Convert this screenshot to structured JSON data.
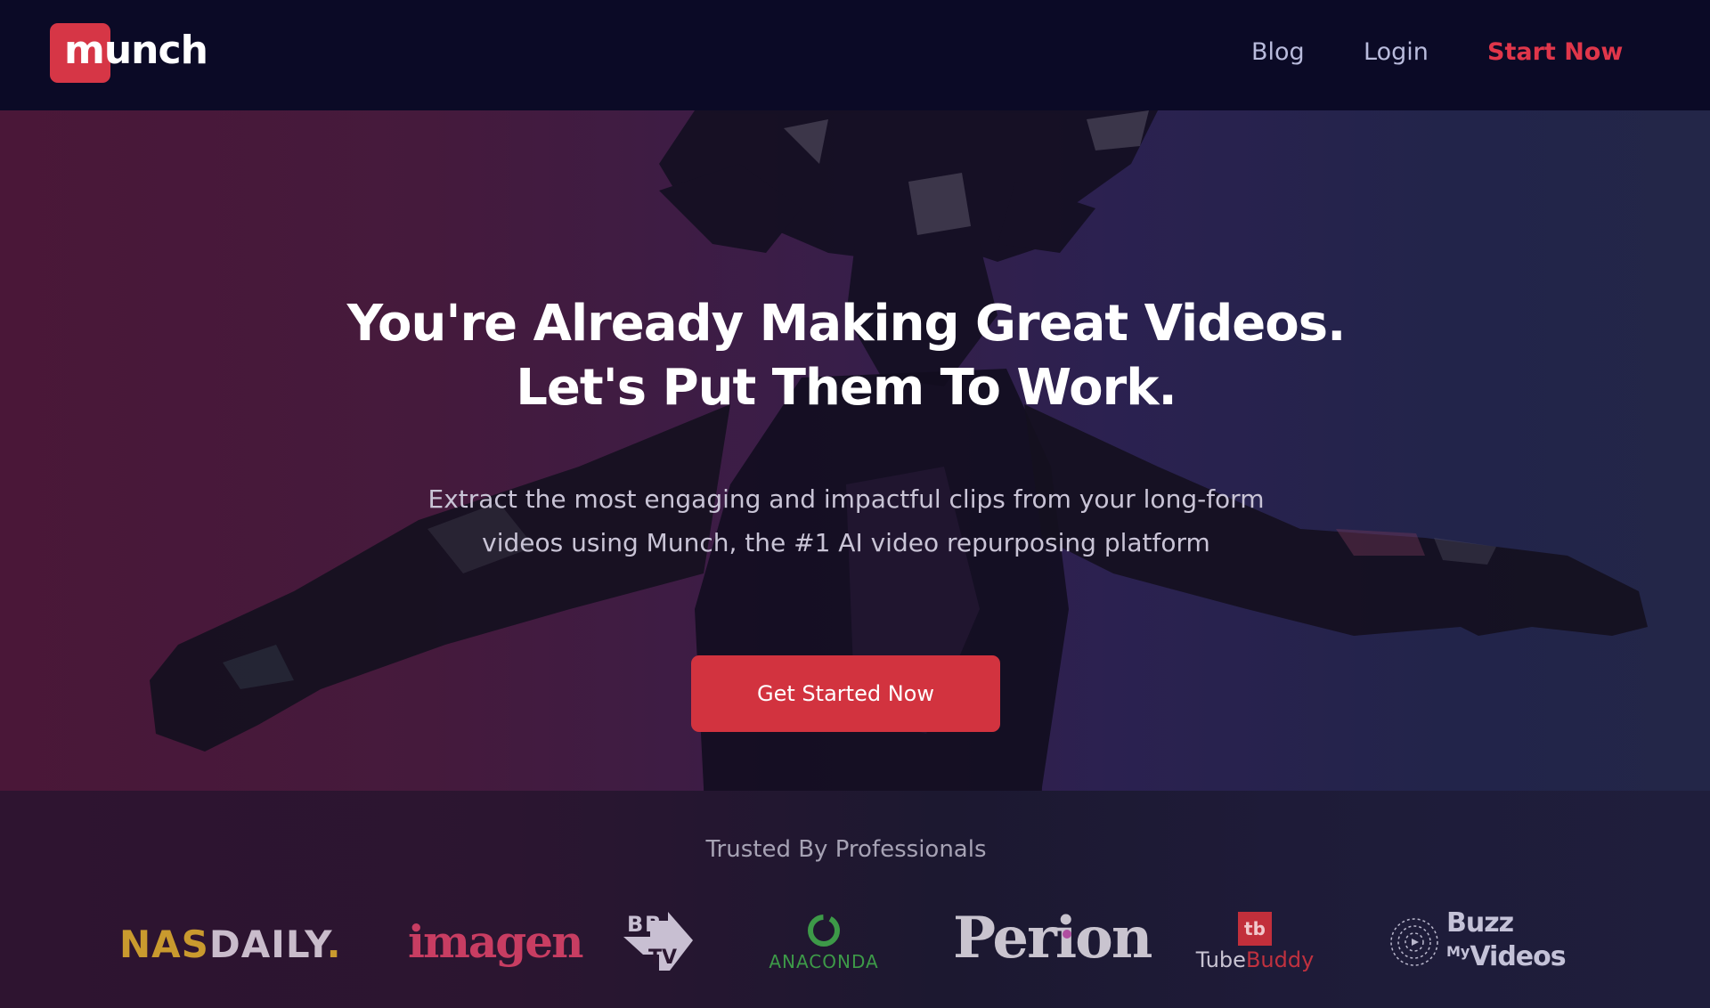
{
  "nav": {
    "logo_text": "munch",
    "links": [
      {
        "label": "Blog"
      },
      {
        "label": "Login"
      },
      {
        "label": "Start Now"
      }
    ],
    "accent_color": "#e0364a"
  },
  "hero": {
    "headline_line1": "You're Already Making Great Videos.",
    "headline_line2": "Let's Put Them To Work.",
    "subtitle_line1": "Extract the most engaging and impactful clips from your long-form",
    "subtitle_line2": "videos using Munch, the #1 AI video repurposing platform",
    "cta_label": "Get Started Now",
    "cta_color": "#d2333f"
  },
  "trusted": {
    "title": "Trusted By Professionals",
    "logos": [
      {
        "name": "NASDAILY",
        "parts": [
          "NAS",
          "DAILY",
          "."
        ]
      },
      {
        "name": "imagen",
        "text": "imagen"
      },
      {
        "name": "BBTV",
        "text": "BBTV"
      },
      {
        "name": "ANACONDA",
        "text": "ANACONDA"
      },
      {
        "name": "Perion",
        "text": "Perion"
      },
      {
        "name": "TubeBuddy",
        "badge": "tb",
        "parts": [
          "Tube",
          "Buddy"
        ]
      },
      {
        "name": "Buzz My Videos",
        "parts": [
          "Buzz",
          "My",
          "Videos"
        ]
      }
    ]
  }
}
